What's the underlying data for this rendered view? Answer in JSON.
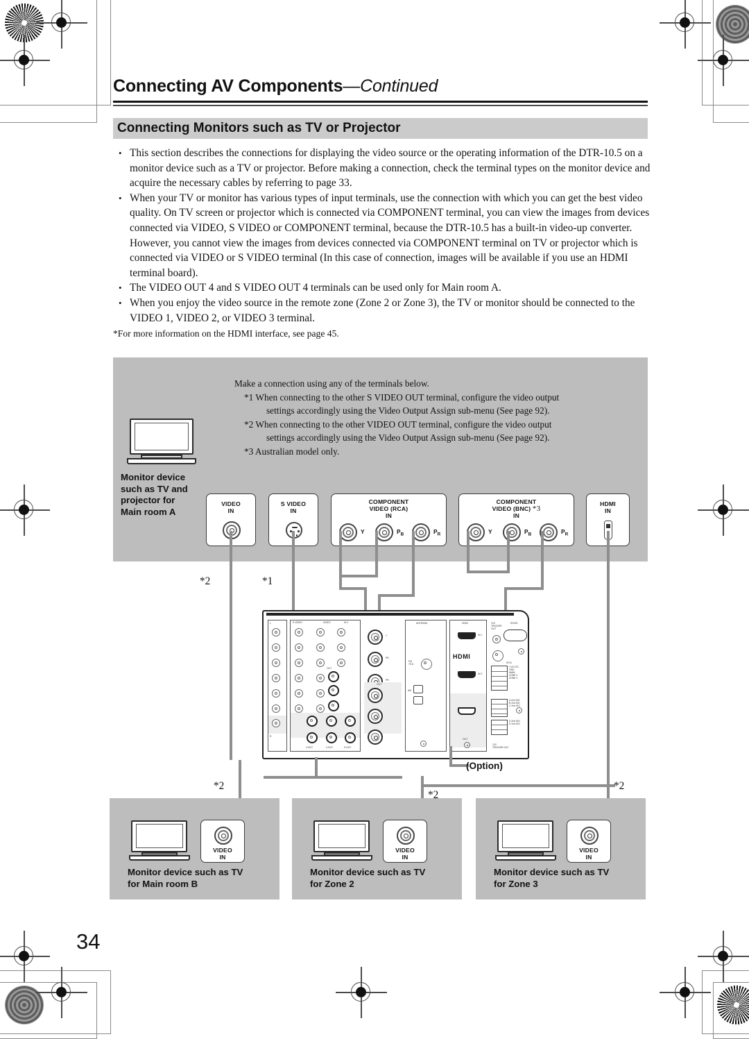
{
  "header": {
    "title_main": "Connecting AV Components",
    "title_cont": "—Continued",
    "section_title": "Connecting Monitors such as TV or Projector"
  },
  "bullets": [
    "This section describes the connections for displaying the video source or the operating information of the DTR-10.5 on a monitor device such as a TV or projector. Before making a connection, check the terminal types on the monitor device and acquire the necessary cables by referring to page 33.",
    "When your TV or monitor has various types of input terminals, use the connection with which you can get the best video quality. On TV screen or projector which is connected via COMPONENT terminal, you can view the images from devices connected via VIDEO, S VIDEO or COMPONENT terminal, because the DTR-10.5 has a built-in video-up converter. However, you cannot view the images from devices connected via COMPONENT terminal on TV or projector which is connected via VIDEO or S VIDEO terminal (In this case of connection, images will be available if you use an HDMI terminal board).",
    "The VIDEO OUT 4 and S VIDEO OUT 4 terminals can be used only for Main room A.",
    "When you enjoy the video source in the remote zone (Zone 2 or Zone 3), the TV or monitor should be connected to the VIDEO 1, VIDEO 2, or VIDEO 3 terminal."
  ],
  "footnote": "*For more information on the HDMI interface, see page 45.",
  "diagram": {
    "intro": "Make a connection using any of the terminals below.",
    "notes": [
      {
        "mark": "*1",
        "line1": "When connecting to the other S VIDEO OUT terminal, configure the video output",
        "line2": "settings accordingly using the Video Output Assign sub-menu (See page 92)."
      },
      {
        "mark": "*2",
        "line1": "When connecting to the other VIDEO OUT terminal, configure the video output",
        "line2": "settings accordingly using the Video Output Assign sub-menu (See page 92)."
      },
      {
        "mark": "*3",
        "line1": "Australian model only.",
        "line2": ""
      }
    ],
    "main_monitor_label": "Monitor device such as TV and projector for Main room A",
    "main_monitor_label_lines": [
      "Monitor device",
      "such as TV and",
      "projector for",
      "Main room A"
    ],
    "terminals": [
      {
        "name": "video-in",
        "cap_lines": [
          "VIDEO",
          "IN"
        ],
        "jacks": []
      },
      {
        "name": "s-video-in",
        "cap_lines": [
          "S VIDEO",
          "IN"
        ],
        "jacks": []
      },
      {
        "name": "component-video-rca-in",
        "cap_lines": [
          "COMPONENT",
          "VIDEO (RCA)",
          "IN"
        ],
        "jacks": [
          "Y",
          "PB",
          "PR"
        ]
      },
      {
        "name": "component-video-bnc-in",
        "cap_lines": [
          "COMPONENT",
          "VIDEO (BNC)",
          "IN"
        ],
        "cap_mark": "*3",
        "jacks": [
          "Y",
          "PB",
          "PR"
        ]
      },
      {
        "name": "hdmi-in",
        "cap_lines": [
          "HDMI",
          "IN"
        ],
        "jacks": []
      }
    ],
    "markers": {
      "m1": "*1",
      "m2": "*2",
      "m3": "*3"
    },
    "option_label": "(Option)",
    "receiver": {
      "hdmi_logo": "HDMI",
      "labels": [
        "COMPONENT",
        "VIDEO",
        "HDMI",
        "RS232",
        "IR IN",
        "ANTENNA",
        "12V TRIGGER OUT",
        "ZONE 2",
        "ZONE 3",
        "MAIN",
        "GND"
      ]
    },
    "bottom_monitors": [
      {
        "name": "main-room-b",
        "lines": [
          "Monitor device such as TV",
          "for Main room B"
        ],
        "jack_cap": [
          "VIDEO",
          "IN"
        ],
        "mark": "*2"
      },
      {
        "name": "zone-2",
        "lines": [
          "Monitor device such as TV",
          "for Zone 2"
        ],
        "jack_cap": [
          "VIDEO",
          "IN"
        ],
        "mark": "*2"
      },
      {
        "name": "zone-3",
        "lines": [
          "Monitor device such as TV",
          "for Zone 3"
        ],
        "jack_cap": [
          "VIDEO",
          "IN"
        ],
        "mark": "*2"
      }
    ]
  },
  "page_number": "34"
}
